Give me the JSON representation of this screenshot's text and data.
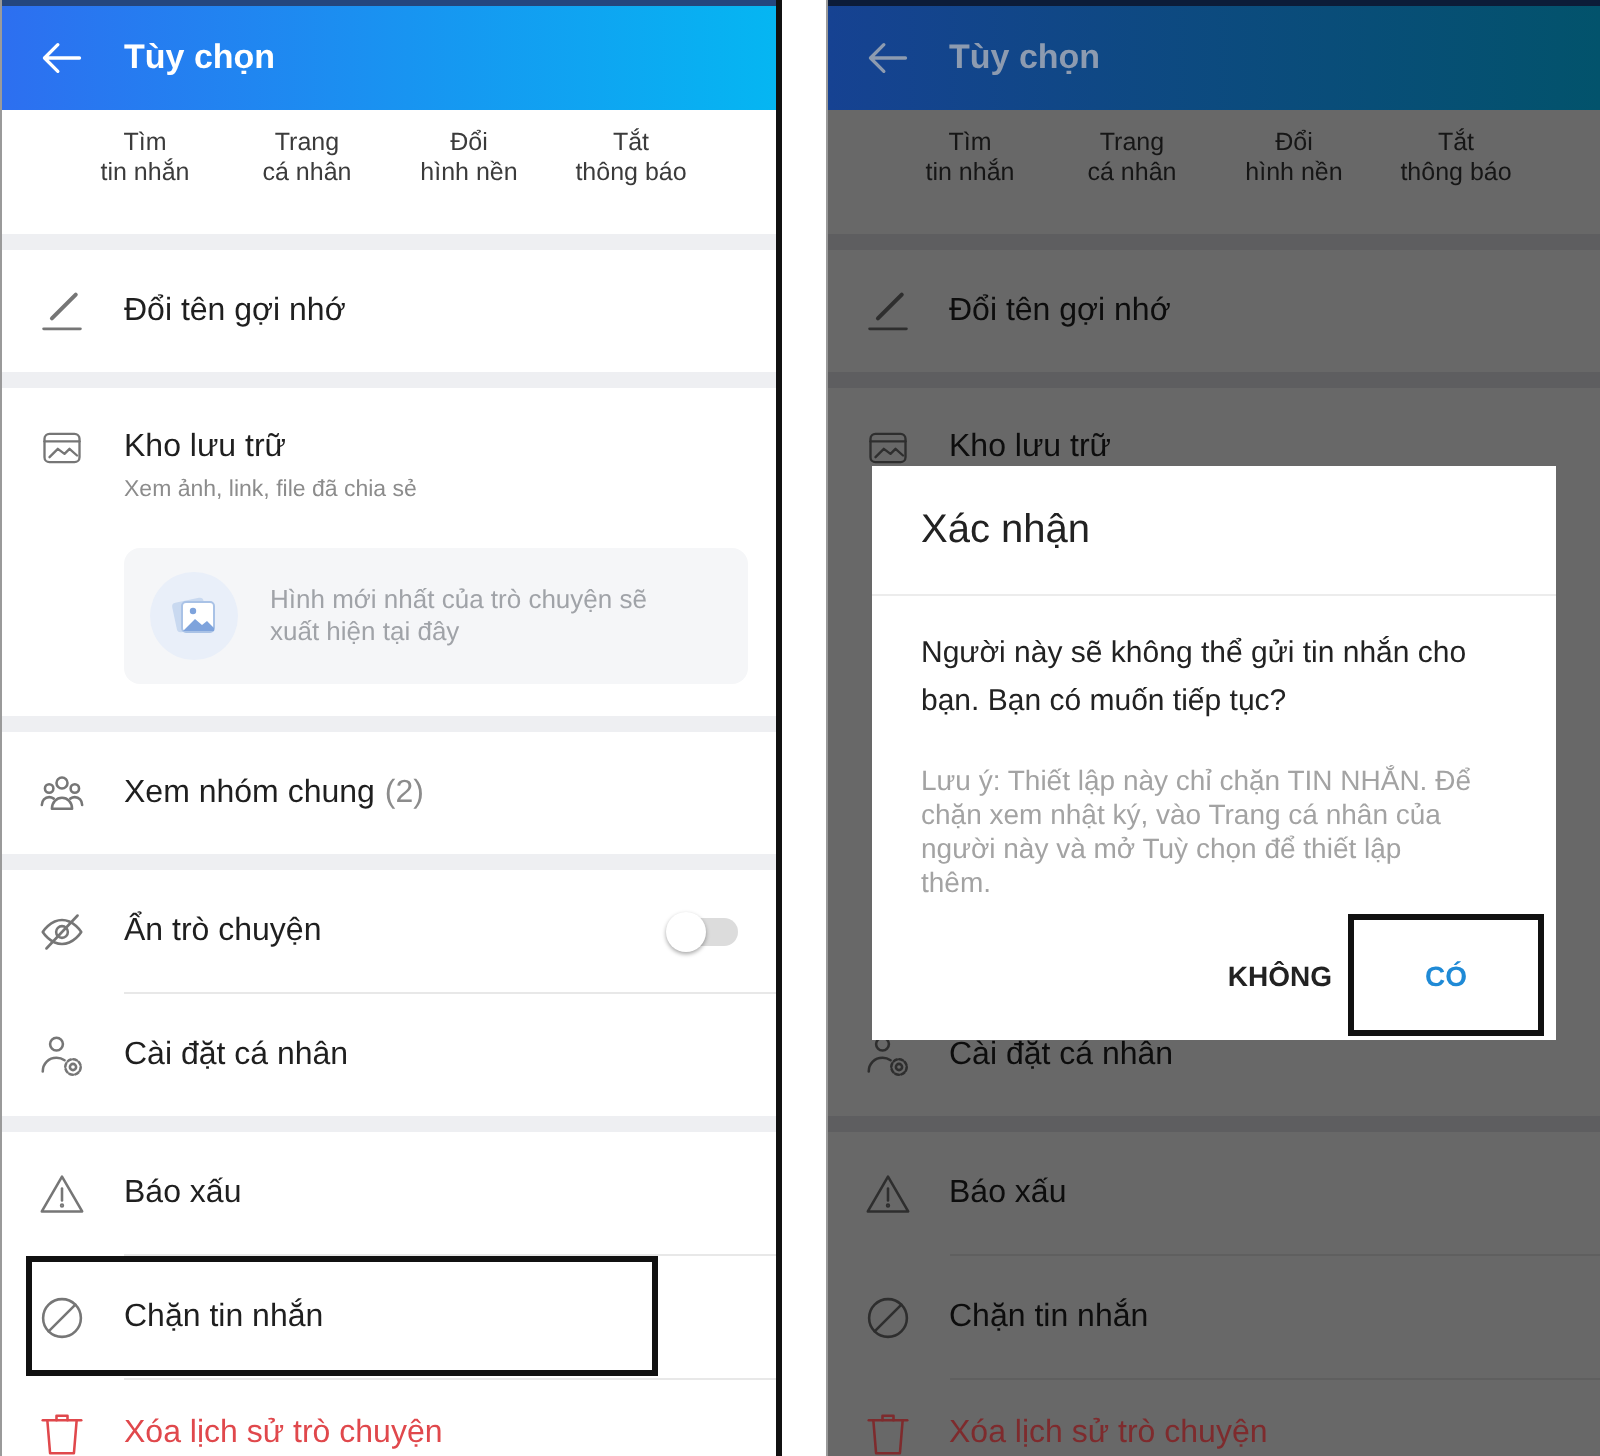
{
  "screens": [
    {
      "dimmed": false,
      "header": {
        "title": "Tùy chọn"
      },
      "quick_actions": [
        {
          "label": "Tìm\ntin nhắn"
        },
        {
          "label": "Trang\ncá nhân"
        },
        {
          "label": "Đổi\nhình nền"
        },
        {
          "label": "Tắt\nthông báo"
        }
      ],
      "sections": [
        {
          "items": [
            {
              "kind": "rename",
              "label": "Đổi tên gợi nhớ",
              "highlighted": false
            }
          ]
        },
        {
          "items": [
            {
              "kind": "storage",
              "label": "Kho lưu trữ",
              "subtitle": "Xem ảnh, link, file đã chia sẻ",
              "preview_text": "Hình mới nhất của trò chuyện sẽ xuất hiện tại đây",
              "highlighted": false
            }
          ]
        },
        {
          "items": [
            {
              "kind": "groups",
              "label": "Xem nhóm chung",
              "count": "(2)",
              "highlighted": false
            }
          ]
        },
        {
          "items": [
            {
              "kind": "hide",
              "label": "Ẩn trò chuyện",
              "on": false,
              "highlighted": false
            },
            {
              "kind": "settings",
              "label": "Cài đặt cá nhân",
              "highlighted": false
            }
          ]
        },
        {
          "items": [
            {
              "kind": "report",
              "label": "Báo xấu",
              "highlighted": false
            },
            {
              "kind": "block",
              "label": "Chặn tin nhắn",
              "highlighted": true
            },
            {
              "kind": "delete",
              "label": "Xóa lịch sử trò chuyện",
              "highlighted": false
            }
          ]
        }
      ]
    },
    {
      "dimmed": true,
      "header": {
        "title": "Tùy chọn"
      },
      "quick_actions": [
        {
          "label": "Tìm\ntin nhắn"
        },
        {
          "label": "Trang\ncá nhân"
        },
        {
          "label": "Đổi\nhình nền"
        },
        {
          "label": "Tắt\nthông báo"
        }
      ],
      "sections": [
        {
          "items": [
            {
              "kind": "rename",
              "label": "Đổi tên gợi nhớ",
              "highlighted": false
            }
          ]
        },
        {
          "items": [
            {
              "kind": "storage",
              "label": "Kho lưu trữ",
              "highlighted": false
            }
          ]
        }
      ],
      "dialog": {
        "title": "Xác nhận",
        "message": "Người này sẽ không thể gửi tin nhắn cho bạn. Bạn có muốn tiếp tục?",
        "note": "Lưu ý: Thiết lập này chỉ chặn TIN NHẮN. Để chặn xem nhật ký, vào Trang cá nhân của người này và mở Tuỳ chọn để thiết lập thêm.",
        "buttons": [
          {
            "kind": "cancel",
            "label": "KHÔNG",
            "highlighted": false
          },
          {
            "kind": "confirm",
            "label": "CÓ",
            "highlighted": true
          }
        ]
      },
      "sections_below": [
        {
          "items": [
            {
              "kind": "settings",
              "label": "Cài đặt cá nhân",
              "highlighted": false
            }
          ]
        },
        {
          "items": [
            {
              "kind": "report",
              "label": "Báo xấu",
              "highlighted": false
            },
            {
              "kind": "block",
              "label": "Chặn tin nhắn",
              "highlighted": false
            },
            {
              "kind": "delete",
              "label": "Xóa lịch sử trò chuyện",
              "highlighted": false
            }
          ]
        }
      ]
    }
  ]
}
